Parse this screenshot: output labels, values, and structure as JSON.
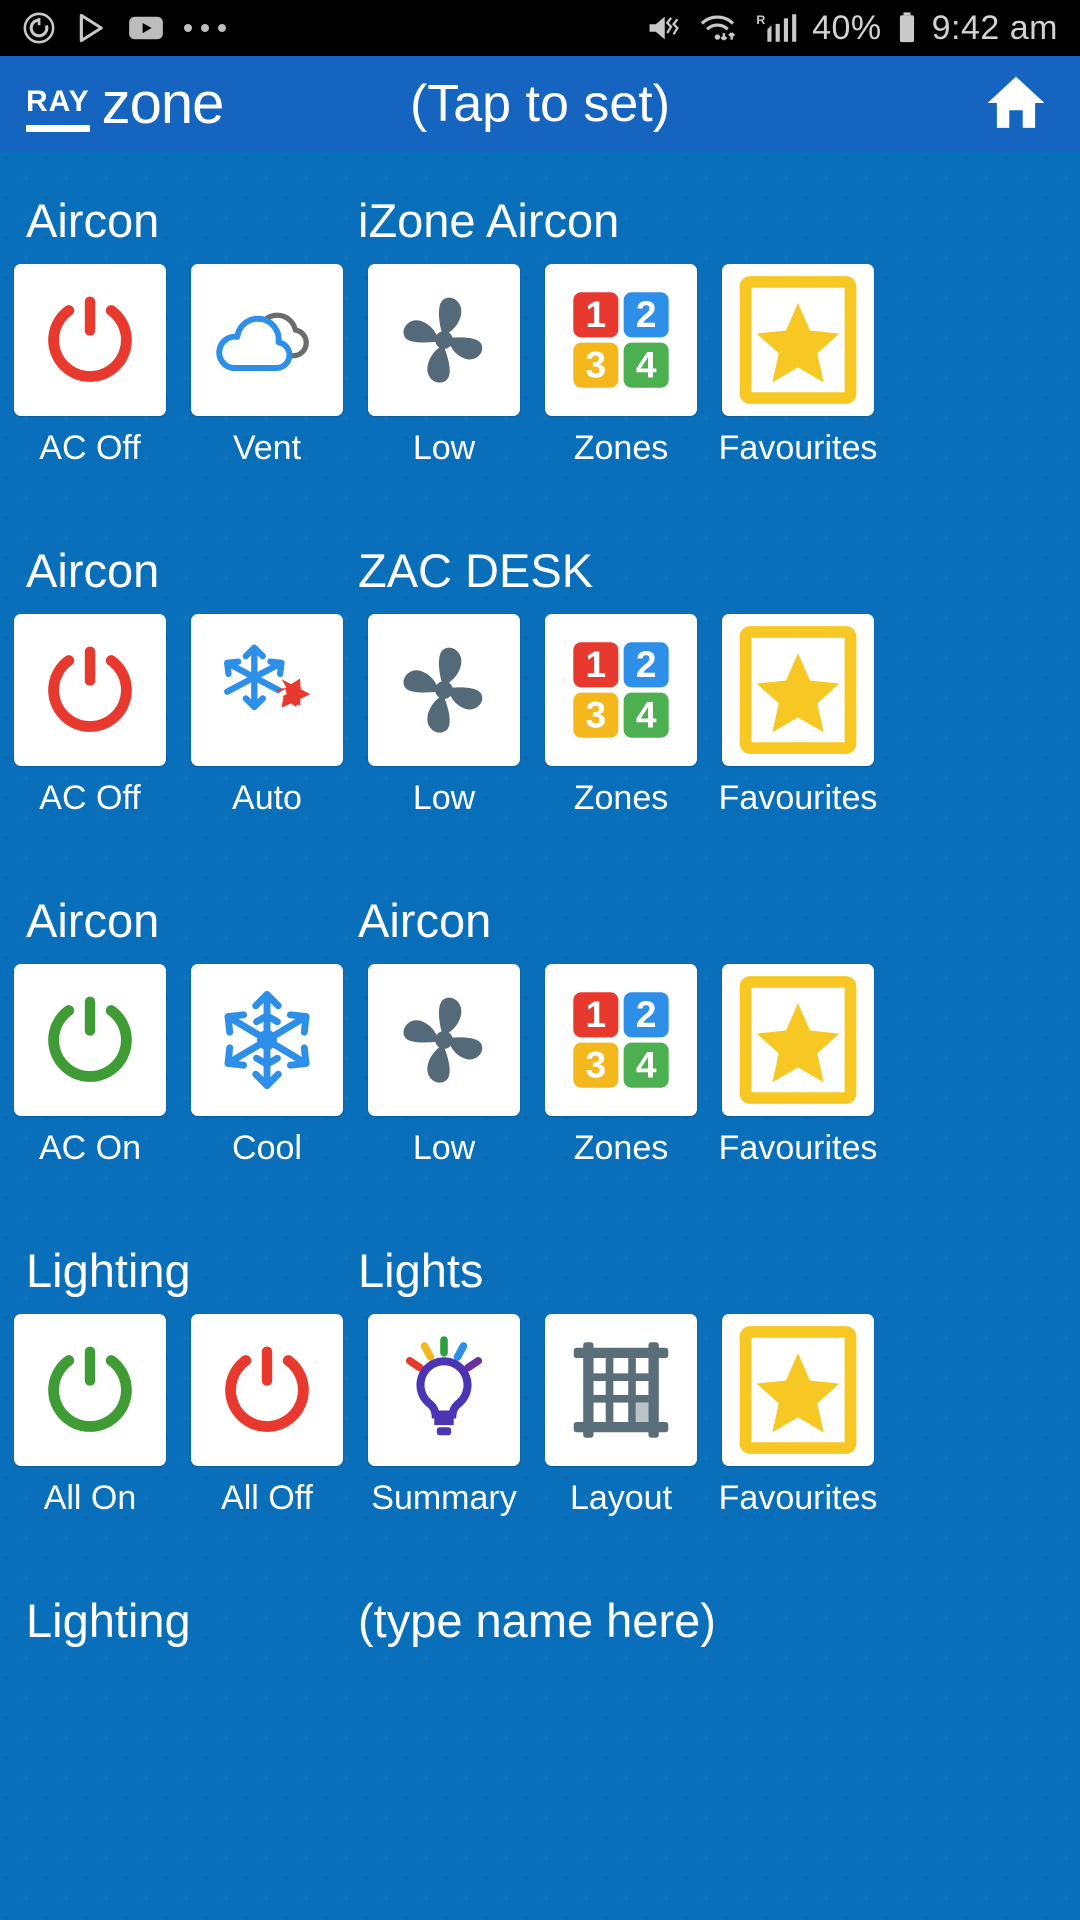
{
  "statusbar": {
    "left_icons": [
      "update-circle-icon",
      "play-store-icon",
      "youtube-icon",
      "overflow-dots-icon"
    ],
    "right_icons": [
      "mute-vibrate-icon",
      "wifi-icon",
      "roaming-signal-icon",
      "battery-icon"
    ],
    "battery_percent": "40%",
    "time": "9:42 am"
  },
  "appbar": {
    "logo_primary": "RAY",
    "logo_secondary": "zone",
    "title": "(Tap to set)",
    "home_icon": "home-icon",
    "background_color": "#1565c0"
  },
  "theme": {
    "page_background": "#0a6fba",
    "tile_background": "#ffffff",
    "power_off_color": "#e8392e",
    "power_on_color": "#3f9c35",
    "cool_color": "#2e8fe8",
    "fan_color": "#546a78",
    "star_color": "#f7c824",
    "zone1_color": "#e8392e",
    "zone2_color": "#2e8fe8",
    "zone3_color": "#f5b81c",
    "zone4_color": "#4caf50"
  },
  "sections": [
    {
      "type_label": "Aircon",
      "name_label": "iZone Aircon",
      "tiles": [
        {
          "icon": "power-off-icon",
          "label": "AC Off"
        },
        {
          "icon": "cloud-vent-icon",
          "label": "Vent"
        },
        {
          "icon": "fan-icon",
          "label": "Low"
        },
        {
          "icon": "zones-icon",
          "label": "Zones"
        },
        {
          "icon": "star-favourites-icon",
          "label": "Favourites"
        }
      ]
    },
    {
      "type_label": "Aircon",
      "name_label": "ZAC DESK",
      "tiles": [
        {
          "icon": "power-off-icon",
          "label": "AC Off"
        },
        {
          "icon": "auto-snowflake-sun-icon",
          "label": "Auto"
        },
        {
          "icon": "fan-icon",
          "label": "Low"
        },
        {
          "icon": "zones-icon",
          "label": "Zones"
        },
        {
          "icon": "star-favourites-icon",
          "label": "Favourites"
        }
      ]
    },
    {
      "type_label": "Aircon",
      "name_label": "Aircon",
      "tiles": [
        {
          "icon": "power-on-icon",
          "label": "AC On"
        },
        {
          "icon": "snowflake-icon",
          "label": "Cool"
        },
        {
          "icon": "fan-icon",
          "label": "Low"
        },
        {
          "icon": "zones-icon",
          "label": "Zones"
        },
        {
          "icon": "star-favourites-icon",
          "label": "Favourites"
        }
      ]
    },
    {
      "type_label": "Lighting",
      "name_label": "Lights",
      "tiles": [
        {
          "icon": "power-on-icon",
          "label": "All On"
        },
        {
          "icon": "power-off-icon",
          "label": "All Off"
        },
        {
          "icon": "lightbulb-icon",
          "label": "Summary"
        },
        {
          "icon": "layout-grid-icon",
          "label": "Layout"
        },
        {
          "icon": "star-favourites-icon",
          "label": "Favourites"
        }
      ]
    },
    {
      "type_label": "Lighting",
      "name_label": "(type name here)",
      "tiles": []
    }
  ],
  "zones": {
    "numbers": [
      "1",
      "2",
      "3",
      "4"
    ]
  }
}
